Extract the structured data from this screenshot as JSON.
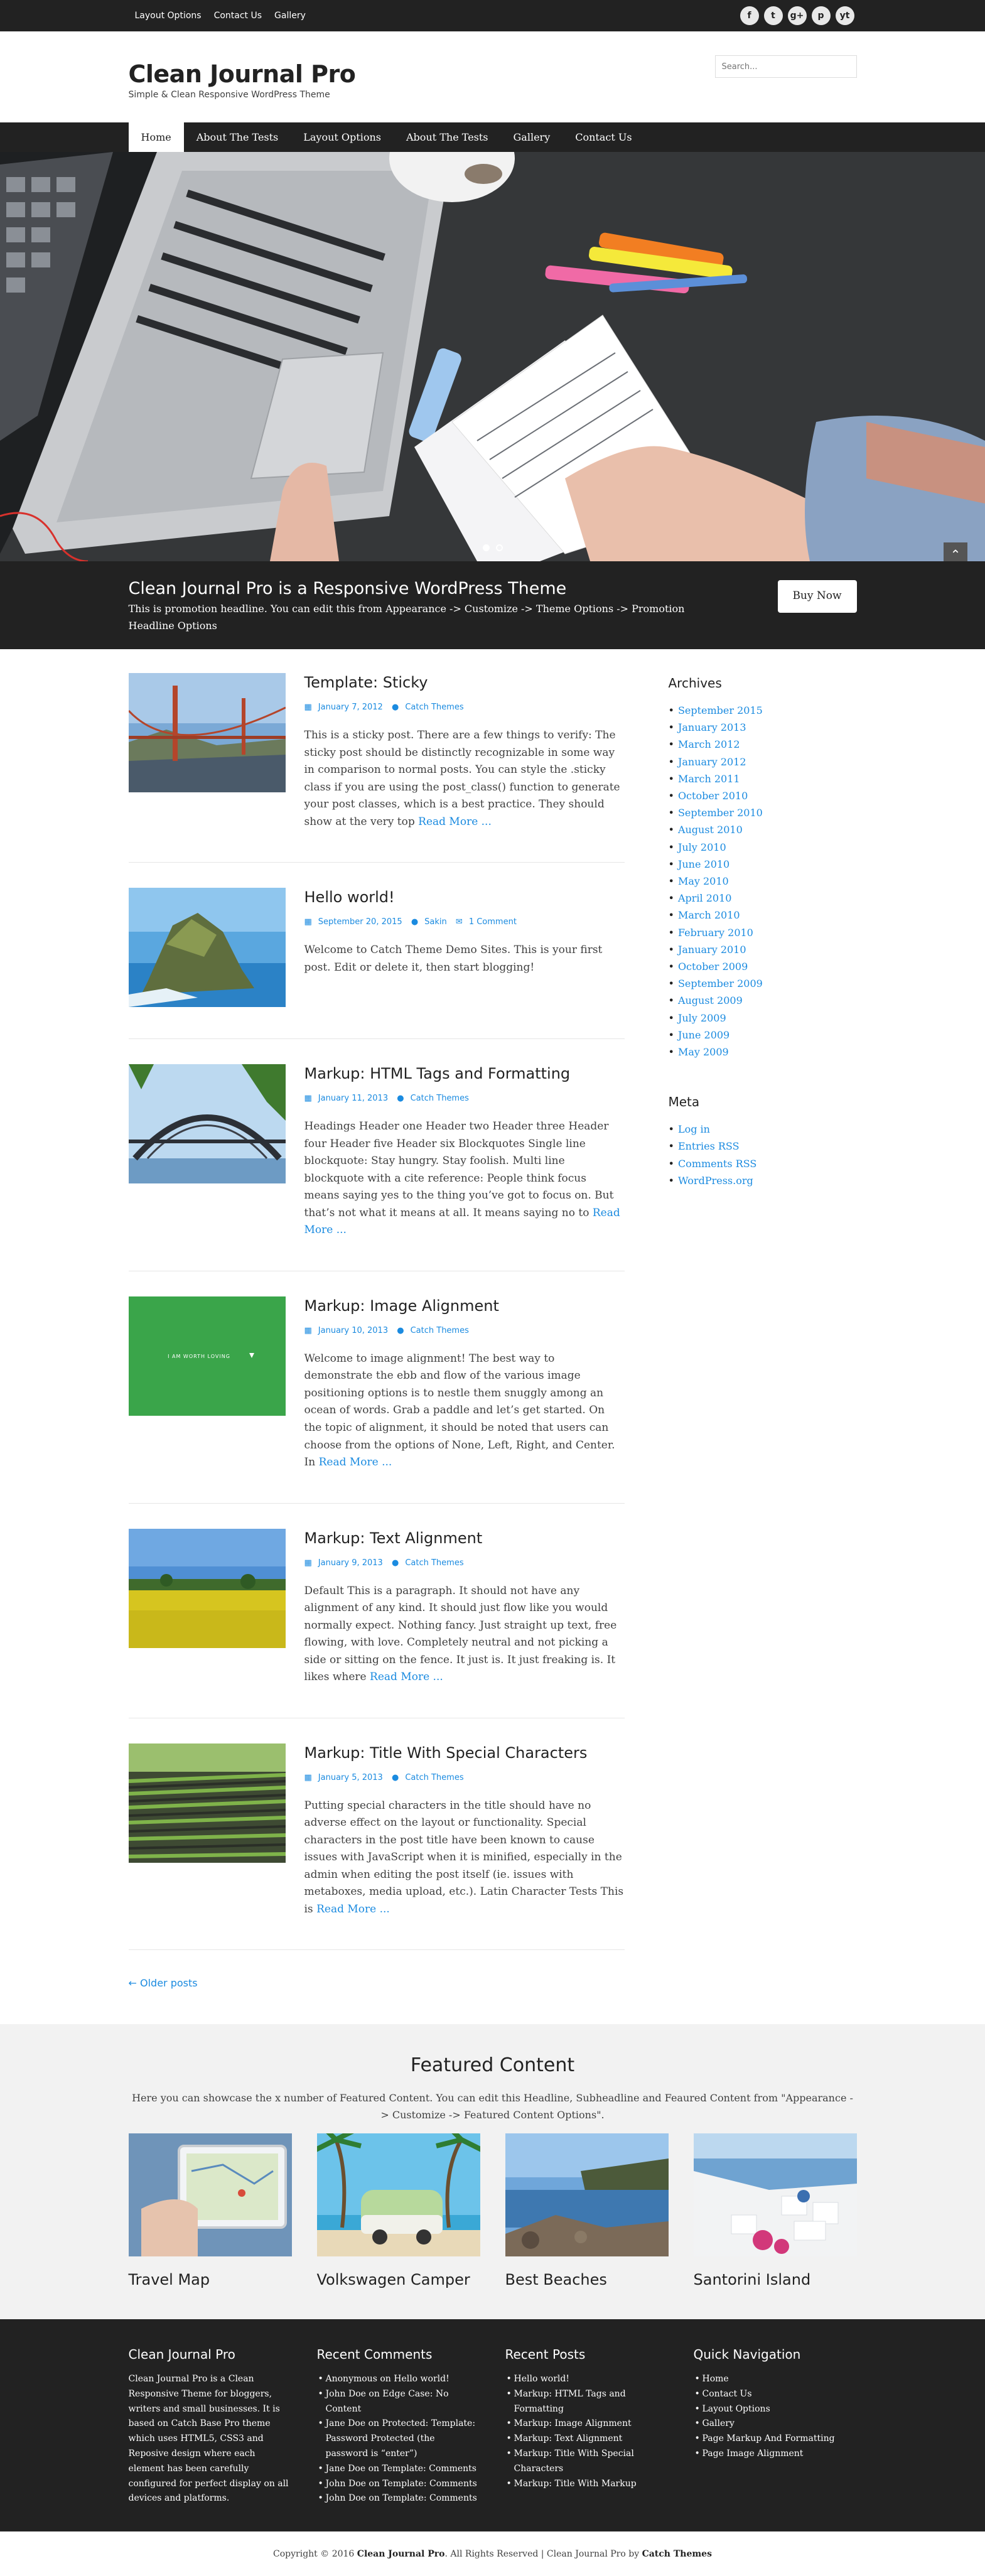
{
  "topbar": {
    "menu": [
      "Layout Options",
      "Contact Us",
      "Gallery"
    ],
    "social": [
      "f",
      "t",
      "g+",
      "p",
      "yt"
    ]
  },
  "header": {
    "title": "Clean Journal Pro",
    "tagline": "Simple & Clean Responsive WordPress Theme",
    "search_placeholder": "Search..."
  },
  "nav": {
    "items": [
      "Home",
      "About The Tests",
      "Layout Options",
      "About The Tests",
      "Gallery",
      "Contact Us"
    ]
  },
  "promo": {
    "title": "Clean Journal Pro is a Responsive WordPress Theme",
    "text": "This is promotion headline. You can edit this from Appearance -> Customize -> Theme Options -> Promotion Headline Options",
    "button": "Buy Now"
  },
  "posts": [
    {
      "title": "Template: Sticky",
      "date": "January 7, 2012",
      "author": "Catch Themes",
      "comments": "",
      "excerpt": "This is a sticky post. There are a few things to verify: The sticky post should be distinctly recognizable in some way in comparison to normal posts. You can style the .sticky class if you are using the post_class() function to generate your post classes, which is a best practice. They should show at the very top",
      "more": "Read More ..."
    },
    {
      "title": "Hello world!",
      "date": "September 20, 2015",
      "author": "Sakin",
      "comments": "1 Comment",
      "excerpt": "Welcome to Catch Theme Demo Sites. This is your first post. Edit or delete it, then start blogging!",
      "more": ""
    },
    {
      "title": "Markup: HTML Tags and Formatting",
      "date": "January 11, 2013",
      "author": "Catch Themes",
      "comments": "",
      "excerpt": "Headings Header one Header two Header three Header four Header five Header six Blockquotes Single line blockquote: Stay hungry. Stay foolish. Multi line blockquote with a cite reference: People think focus means saying yes to the thing you’ve got to focus on. But that’s not what it means at all. It means saying no to",
      "more": "Read More ..."
    },
    {
      "title": "Markup: Image Alignment",
      "date": "January 10, 2013",
      "author": "Catch Themes",
      "comments": "",
      "excerpt": "Welcome to image alignment! The best way to demonstrate the ebb and flow of the various image positioning options is to nestle them snuggly among an ocean of words. Grab a paddle and let’s get started. On the topic of alignment, it should be noted that users can choose from the options of None, Left, Right, and Center. In",
      "more": "Read More ..."
    },
    {
      "title": "Markup: Text Alignment",
      "date": "January 9, 2013",
      "author": "Catch Themes",
      "comments": "",
      "excerpt": "Default This is a paragraph. It should not have any alignment of any kind. It should just flow like you would normally expect. Nothing fancy. Just straight up text, free flowing, with love. Completely neutral and not picking a side or sitting on the fence. It just is. It just freaking is. It likes where",
      "more": "Read More ..."
    },
    {
      "title": "Markup: Title With Special Characters",
      "date": "January 5, 2013",
      "author": "Catch Themes",
      "comments": "",
      "excerpt": "Putting special characters in the title should have no adverse effect on the layout or functionality. Special characters in the post title have been known to cause issues with JavaScript when it is minified, especially in the admin when editing the post itself (ie. issues with metaboxes, media upload, etc.). Latin Character Tests This is",
      "more": "Read More ..."
    }
  ],
  "older_posts": "← Older posts",
  "image_alignment_caption": "I AM WORTH LOVING",
  "sidebar": {
    "archives_title": "Archives",
    "archives": [
      "September 2015",
      "January 2013",
      "March 2012",
      "January 2012",
      "March 2011",
      "October 2010",
      "September 2010",
      "August 2010",
      "July 2010",
      "June 2010",
      "May 2010",
      "April 2010",
      "March 2010",
      "February 2010",
      "January 2010",
      "October 2009",
      "September 2009",
      "August 2009",
      "July 2009",
      "June 2009",
      "May 2009"
    ],
    "meta_title": "Meta",
    "meta": [
      "Log in",
      "Entries RSS",
      "Comments RSS",
      "WordPress.org"
    ]
  },
  "featured": {
    "title": "Featured Content",
    "text": "Here you can showcase the x number of Featured Content. You can edit this Headline, Subheadline and Feaured Content from \"Appearance -> Customize -> Featured Content Options\".",
    "items": [
      "Travel Map",
      "Volkswagen Camper",
      "Best Beaches",
      "Santorini Island"
    ]
  },
  "footer": {
    "col1_title": "Clean Journal Pro",
    "col1_text": "Clean Journal Pro is a Clean Responsive Theme for bloggers, writers and small businesses. It is based on Catch Base Pro theme which uses HTML5, CSS3 and Reposive design where each element has been carefully configured for perfect display on all devices and platforms.",
    "col2_title": "Recent Comments",
    "col2": [
      "Anonymous on Hello world!",
      "John Doe on Edge Case: No Content",
      "Jane Doe on Protected: Template: Password Protected (the password is “enter”)",
      "Jane Doe on Template: Comments",
      "John Doe on Template: Comments",
      "John Doe on Template: Comments"
    ],
    "col3_title": "Recent Posts",
    "col3": [
      "Hello world!",
      "Markup: HTML Tags and Formatting",
      "Markup: Image Alignment",
      "Markup: Text Alignment",
      "Markup: Title With Special Characters",
      "Markup: Title With Markup"
    ],
    "col4_title": "Quick Navigation",
    "col4": [
      "Home",
      "Contact Us",
      "Layout Options",
      "Gallery",
      "Page Markup And Formatting",
      "Page Image Alignment"
    ]
  },
  "copyright": {
    "prefix": "Copyright © 2016",
    "site": "Clean Journal Pro",
    "middle": ". All Rights Reserved | Clean Journal Pro by",
    "author": "Catch Themes"
  }
}
